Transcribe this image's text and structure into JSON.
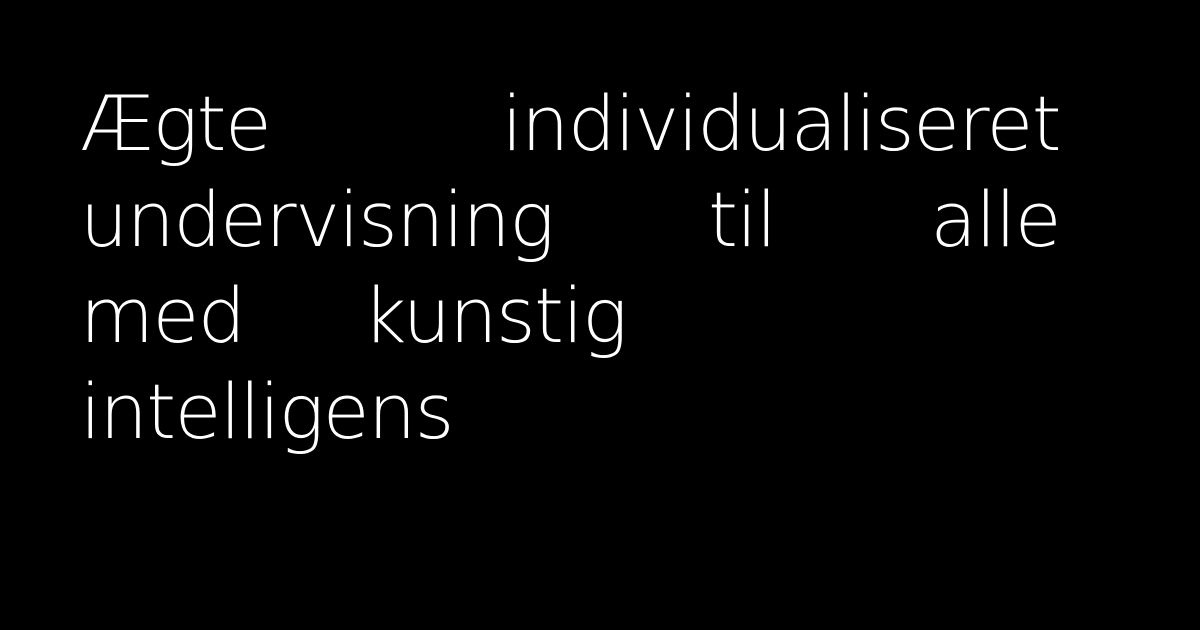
{
  "background_color": "#000000",
  "text_color": "#ffffff",
  "headline": {
    "full_text": "Ægte individualiseret undervisning til alle med kunstig intelligens",
    "lines": [
      [
        "Ægte",
        "individualiseret"
      ],
      [
        "undervisning",
        "til",
        "alle"
      ],
      [
        "med",
        "kunstig"
      ],
      [
        "intelligens"
      ]
    ]
  }
}
